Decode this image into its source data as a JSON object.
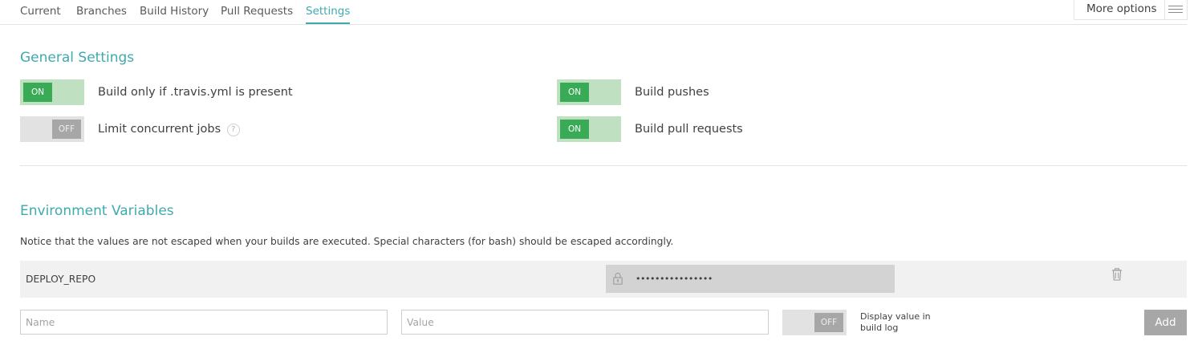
{
  "tabs": [
    {
      "label": "Current",
      "active": false
    },
    {
      "label": "Branches",
      "active": false
    },
    {
      "label": "Build History",
      "active": false
    },
    {
      "label": "Pull Requests",
      "active": false
    },
    {
      "label": "Settings",
      "active": true
    }
  ],
  "more_options": {
    "label": "More options",
    "icon": "hamburger-icon"
  },
  "general_settings": {
    "title": "General Settings",
    "settings": [
      {
        "label": "Build only if .travis.yml is present",
        "state": "ON"
      },
      {
        "label": "Limit concurrent jobs",
        "state": "OFF",
        "help": "?"
      },
      {
        "label": "Build pushes",
        "state": "ON"
      },
      {
        "label": "Build pull requests",
        "state": "ON"
      }
    ]
  },
  "env_vars": {
    "title": "Environment Variables",
    "notice": "Notice that the values are not escaped when your builds are executed. Special characters (for bash) should be escaped accordingly.",
    "items": [
      {
        "name": "DEPLOY_REPO",
        "value": "••••••••••••••••",
        "icon": "lock-icon",
        "delete_icon": "trash-icon"
      }
    ],
    "form": {
      "name_placeholder": "Name",
      "value_placeholder": "Value",
      "display_toggle_state": "OFF",
      "display_label": "Display value in build log",
      "add_label": "Add"
    }
  },
  "colors": {
    "accent": "#3eaaaf",
    "toggle_on": "#39aa56",
    "toggle_on_track": "#c0e0c2",
    "toggle_off": "#a7a7a7",
    "toggle_off_track": "#e2e2e2"
  }
}
